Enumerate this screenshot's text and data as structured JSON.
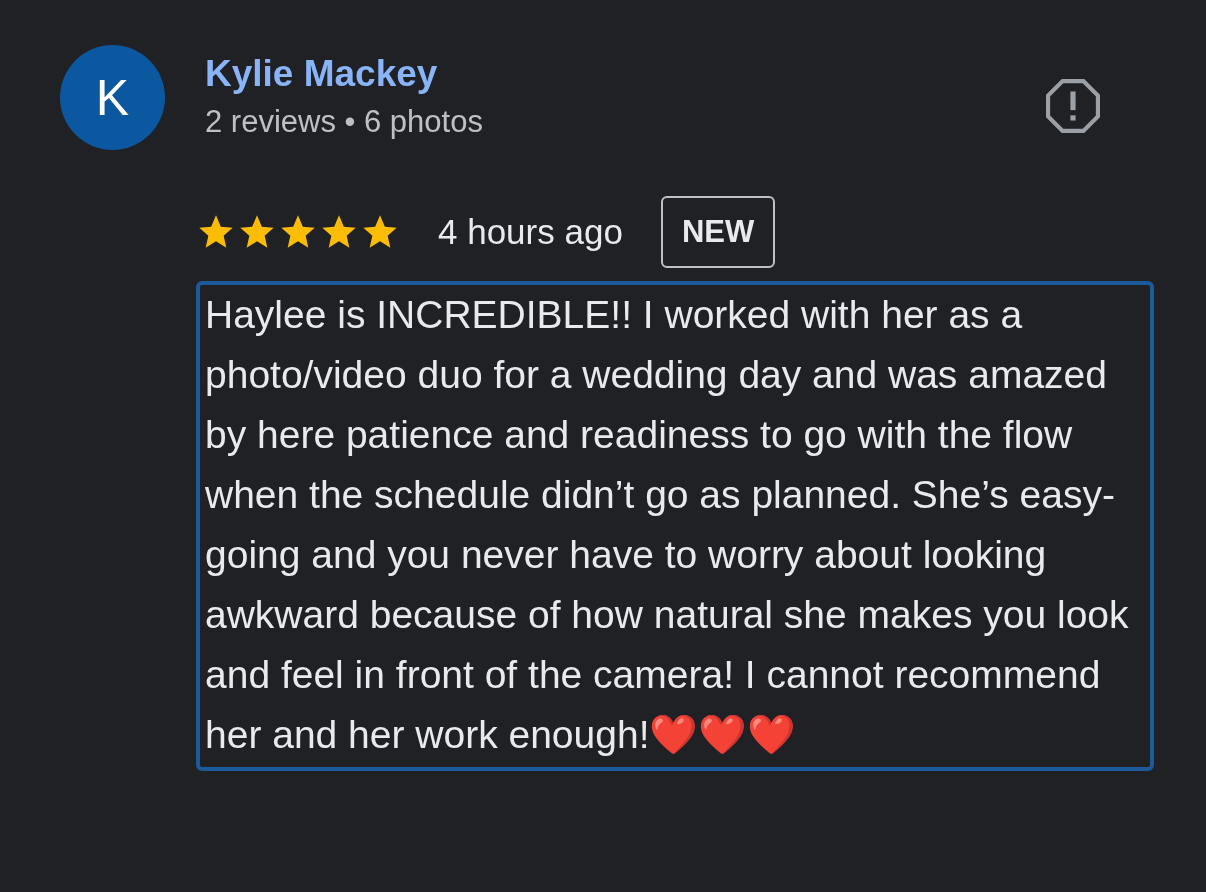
{
  "reviewer": {
    "initial": "K",
    "name": "Kylie Mackey",
    "meta": "2 reviews • 6 photos"
  },
  "review": {
    "stars": 5,
    "time": "4 hours ago",
    "badge": "NEW",
    "text": "Haylee is INCREDIBLE!! I worked with her as a photo/video duo for a wedding day and was amazed by here patience and readiness to go with the flow when the schedule didn’t go as planned. She’s easy-going and you never have to worry about looking awkward because of how natural she makes you look and feel in front of the camera! I cannot recommend her and her work enough!❤️❤️❤️",
    "highlighted": true
  }
}
